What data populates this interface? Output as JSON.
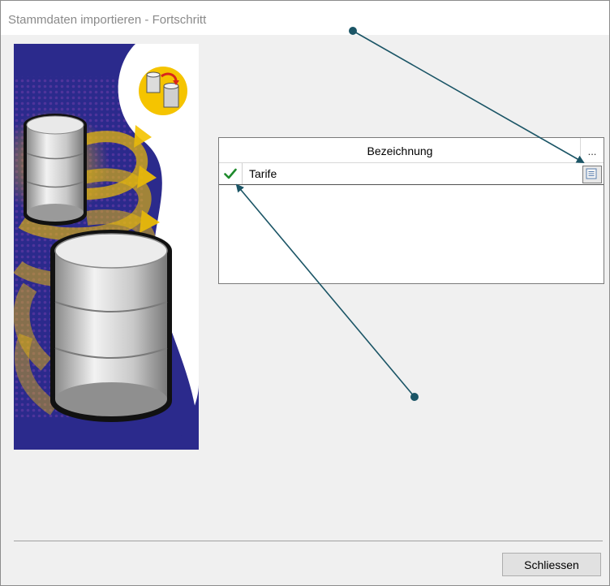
{
  "window": {
    "title": "Stammdaten importieren - Fortschritt"
  },
  "grid": {
    "column_header": "Bezeichnung",
    "header_button": "...",
    "rows": [
      {
        "label": "Tarife",
        "status": "done"
      }
    ]
  },
  "footer": {
    "close_label": "Schliessen"
  },
  "colors": {
    "illustration_bg": "#2b2a8c",
    "accent": "#f5c400",
    "check": "#1e8a2c",
    "arrow": "#1b5566"
  }
}
